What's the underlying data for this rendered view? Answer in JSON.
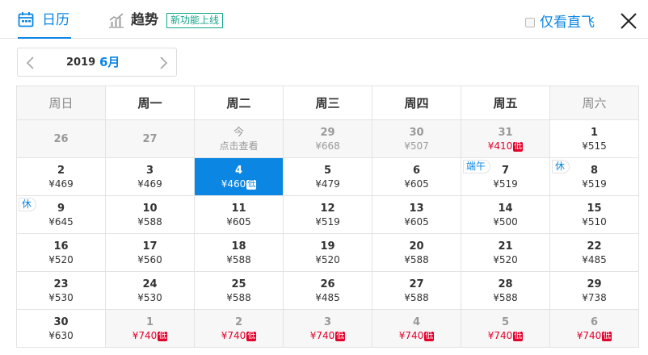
{
  "tabs": {
    "calendar_label": "日历",
    "trend_label": "趋势",
    "new_badge": "新功能上线"
  },
  "direct_only": {
    "label": "仅看直飞",
    "checked": false
  },
  "month_nav": {
    "year": "2019",
    "month": "6月"
  },
  "weekdays": [
    "周日",
    "周一",
    "周二",
    "周三",
    "周四",
    "周五",
    "周六"
  ],
  "low_label": "低",
  "colors": {
    "accent": "#0b86e3",
    "low_price": "#e4002b",
    "badge": "#12a58a"
  },
  "weeks": [
    [
      {
        "day": "26",
        "price": "",
        "state": "past"
      },
      {
        "day": "27",
        "price": "",
        "state": "past"
      },
      {
        "day": "今",
        "price": "点击查看",
        "state": "today"
      },
      {
        "day": "29",
        "price": "¥668",
        "state": "past"
      },
      {
        "day": "30",
        "price": "¥507",
        "state": "past"
      },
      {
        "day": "31",
        "price": "¥410",
        "state": "past",
        "low": true
      },
      {
        "day": "1",
        "price": "¥515"
      }
    ],
    [
      {
        "day": "2",
        "price": "¥469"
      },
      {
        "day": "3",
        "price": "¥469"
      },
      {
        "day": "4",
        "price": "¥460",
        "state": "selected",
        "low": true
      },
      {
        "day": "5",
        "price": "¥479"
      },
      {
        "day": "6",
        "price": "¥605"
      },
      {
        "day": "7",
        "price": "¥519",
        "holiday": "端午"
      },
      {
        "day": "8",
        "price": "¥519",
        "holiday": "休"
      }
    ],
    [
      {
        "day": "9",
        "price": "¥645",
        "holiday": "休"
      },
      {
        "day": "10",
        "price": "¥588"
      },
      {
        "day": "11",
        "price": "¥605"
      },
      {
        "day": "12",
        "price": "¥519"
      },
      {
        "day": "13",
        "price": "¥605"
      },
      {
        "day": "14",
        "price": "¥500"
      },
      {
        "day": "15",
        "price": "¥510"
      }
    ],
    [
      {
        "day": "16",
        "price": "¥520"
      },
      {
        "day": "17",
        "price": "¥560"
      },
      {
        "day": "18",
        "price": "¥588"
      },
      {
        "day": "19",
        "price": "¥520"
      },
      {
        "day": "20",
        "price": "¥588"
      },
      {
        "day": "21",
        "price": "¥520"
      },
      {
        "day": "22",
        "price": "¥485"
      }
    ],
    [
      {
        "day": "23",
        "price": "¥530"
      },
      {
        "day": "24",
        "price": "¥530"
      },
      {
        "day": "25",
        "price": "¥588"
      },
      {
        "day": "26",
        "price": "¥485"
      },
      {
        "day": "27",
        "price": "¥588"
      },
      {
        "day": "28",
        "price": "¥588"
      },
      {
        "day": "29",
        "price": "¥738"
      }
    ],
    [
      {
        "day": "30",
        "price": "¥630"
      },
      {
        "day": "1",
        "price": "¥740",
        "state": "future",
        "low": true
      },
      {
        "day": "2",
        "price": "¥740",
        "state": "future",
        "low": true
      },
      {
        "day": "3",
        "price": "¥740",
        "state": "future",
        "low": true
      },
      {
        "day": "4",
        "price": "¥740",
        "state": "future",
        "low": true
      },
      {
        "day": "5",
        "price": "¥740",
        "state": "future",
        "low": true
      },
      {
        "day": "6",
        "price": "¥740",
        "state": "future",
        "low": true
      }
    ]
  ]
}
